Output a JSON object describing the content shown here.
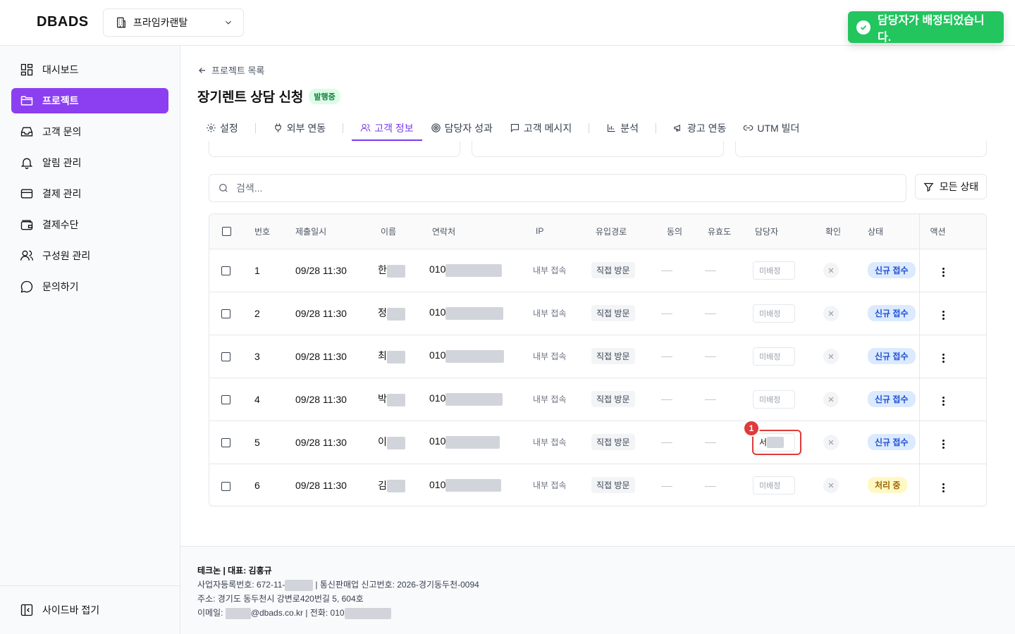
{
  "header": {
    "logo": "DBADS",
    "org_name": "프라임카랜탈"
  },
  "toast": {
    "message": "담당자가 배정되었습니다."
  },
  "sidebar": {
    "items": [
      {
        "label": "대시보드",
        "icon": "dashboard-icon",
        "active": false
      },
      {
        "label": "프로젝트",
        "icon": "folder-icon",
        "active": true
      },
      {
        "label": "고객 문의",
        "icon": "inbox-icon",
        "active": false
      },
      {
        "label": "알림 관리",
        "icon": "bell-icon",
        "active": false
      },
      {
        "label": "결제 관리",
        "icon": "credit-card-icon",
        "active": false
      },
      {
        "label": "결제수단",
        "icon": "wallet-icon",
        "active": false
      },
      {
        "label": "구성원 관리",
        "icon": "users-icon",
        "active": false
      },
      {
        "label": "문의하기",
        "icon": "chat-icon",
        "active": false
      }
    ],
    "collapse_label": "사이드바 접기"
  },
  "page": {
    "back_label": "프로젝트 목록",
    "title": "장기렌트 상담 신청",
    "status_badge": "발행중"
  },
  "tabs": [
    {
      "label": "설정",
      "icon": "gear-icon",
      "active": false
    },
    {
      "label": "외부 연동",
      "icon": "plug-icon",
      "active": false
    },
    {
      "label": "고객 정보",
      "icon": "users-icon",
      "active": true
    },
    {
      "label": "담당자 성과",
      "icon": "target-icon",
      "active": false
    },
    {
      "label": "고객 메시지",
      "icon": "message-icon",
      "active": false
    },
    {
      "label": "분석",
      "icon": "bar-chart-icon",
      "active": false
    },
    {
      "label": "광고 연동",
      "icon": "megaphone-icon",
      "active": false
    },
    {
      "label": "UTM 빌더",
      "icon": "link-icon",
      "active": false
    }
  ],
  "search": {
    "placeholder": "검색..."
  },
  "filter": {
    "label": "모든 상태"
  },
  "table": {
    "headers": [
      "번호",
      "제출일시",
      "이름",
      "연락처",
      "IP",
      "유입경로",
      "동의",
      "유효도",
      "담당자",
      "확인",
      "상태",
      "액션"
    ],
    "rows": [
      {
        "no": "1",
        "date": "09/28 11:30",
        "name": "한",
        "phone": "010",
        "ip": "내부 접속",
        "source": "직접 방문",
        "assignee": "미배정",
        "status": "신규 접수",
        "status_type": "new"
      },
      {
        "no": "2",
        "date": "09/28 11:30",
        "name": "정",
        "phone": "010",
        "ip": "내부 접속",
        "source": "직접 방문",
        "assignee": "미배정",
        "status": "신규 접수",
        "status_type": "new"
      },
      {
        "no": "3",
        "date": "09/28 11:30",
        "name": "최",
        "phone": "010",
        "ip": "내부 접속",
        "source": "직접 방문",
        "assignee": "미배정",
        "status": "신규 접수",
        "status_type": "new"
      },
      {
        "no": "4",
        "date": "09/28 11:30",
        "name": "박",
        "phone": "010",
        "ip": "내부 접속",
        "source": "직접 방문",
        "assignee": "미배정",
        "status": "신규 접수",
        "status_type": "new"
      },
      {
        "no": "5",
        "date": "09/28 11:30",
        "name": "이",
        "phone": "010",
        "ip": "내부 접속",
        "source": "직접 방문",
        "assignee": "서",
        "status": "신규 접수",
        "status_type": "new"
      },
      {
        "no": "6",
        "date": "09/28 11:30",
        "name": "김",
        "phone": "010",
        "ip": "내부 접속",
        "source": "직접 방문",
        "assignee": "미배정",
        "status": "처리 중",
        "status_type": "proc"
      }
    ]
  },
  "annotation": {
    "marker": "1"
  },
  "footer": {
    "line1": "테크논 | 대표: 김홍규",
    "line2a": "사업자등록번호: 672-11-",
    "line2b": "| 통신판매업 신고번호: 2026-경기동두천-0094",
    "line3": "주소: 경기도 동두천시 강변로420번길 5, 604호",
    "line4a": "이메일:",
    "line4b": "@dbads.co.kr | 전화: 010"
  },
  "colors": {
    "accent": "#8b3ff1",
    "toast": "#22c55e",
    "highlight": "#e03b3b"
  }
}
